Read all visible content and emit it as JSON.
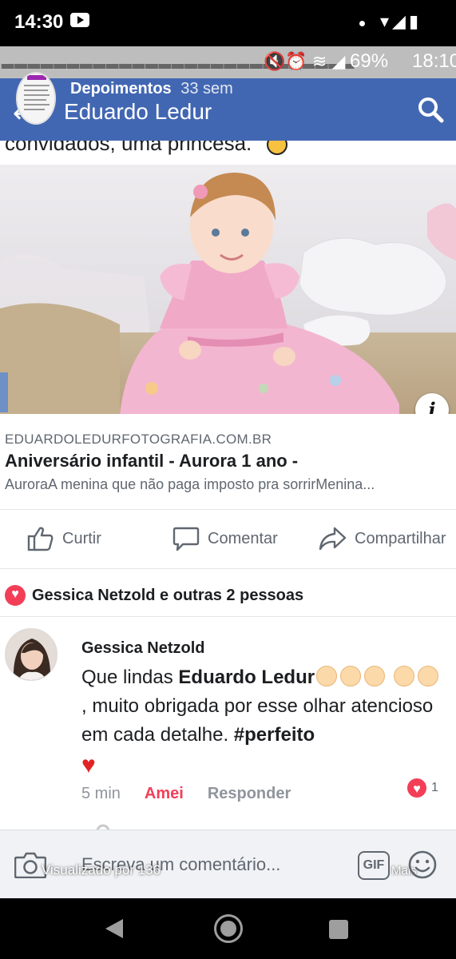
{
  "device_status": {
    "time": "14:30",
    "right_icons": "▾◢▮"
  },
  "inner_status": {
    "icons": "🔇⏰ ≋ ◢",
    "battery": "69%",
    "time": "18:10"
  },
  "header": {
    "section": "Depoimentos",
    "age": "33 sem",
    "title": "Eduardo Ledur",
    "story_thumb_icon": "story-thumbnail",
    "back_icon": "arrow-left-icon",
    "search_icon": "search-icon"
  },
  "post": {
    "caption_clipped": "convidados, uma princesa."
  },
  "link_preview": {
    "domain": "EDUARDOLEDURFOTOGRAFIA.COM.BR",
    "title": "Aniversário infantil - Aurora 1 ano -",
    "description": "AuroraA menina que não paga imposto pra sorrirMenina...",
    "info_label": "i"
  },
  "actions": {
    "like": "Curtir",
    "comment": "Comentar",
    "share": "Compartilhar"
  },
  "reactions": {
    "summary": "Gessica Netzold e outras 2 pessoas",
    "icon": "heart-reaction-icon"
  },
  "comment": {
    "author": "Gessica Netzold",
    "text_start": "Que lindas ",
    "mention": "Eduardo Ledur",
    "text_mid": ", muito obrigada por esse olhar atencioso em cada detalhe. ",
    "hashtag": "#perfeito",
    "heart": "♥",
    "time": "5 min",
    "reaction_label": "Amei",
    "reply_label": "Responder",
    "reaction_count": "1",
    "reaction_heart": "♥"
  },
  "composer": {
    "placeholder": "Escreva um comentário...",
    "viewed_overlay": "Visualizado por 136",
    "gif_label": "GIF",
    "more_overlay": "Mais"
  },
  "colors": {
    "facebook_blue": "#4267b2",
    "love_red": "#f33e58",
    "meta_gray": "#90949c"
  }
}
